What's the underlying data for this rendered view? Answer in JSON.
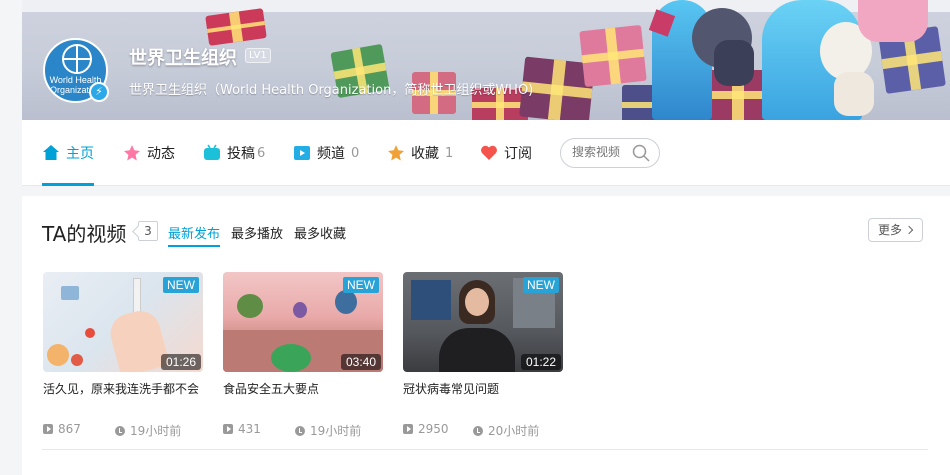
{
  "header": {
    "user_name": "世界卫生组织",
    "level": "LV1",
    "signature": "世界卫生组织（World Health Organization，简称世卫组织或WHO)",
    "avatar_text": "World Health Organization"
  },
  "nav": {
    "items": [
      {
        "label": "主页",
        "count": "",
        "icon": "home-icon",
        "color": "#00a1d6"
      },
      {
        "label": "动态",
        "count": "",
        "icon": "dynamic-icon",
        "color": "#ff77a5"
      },
      {
        "label": "投稿",
        "count": "6",
        "icon": "upload-icon",
        "color": "#1cc0d9"
      },
      {
        "label": "频道",
        "count": "0",
        "icon": "channel-icon",
        "color": "#23ade5"
      },
      {
        "label": "收藏",
        "count": "1",
        "icon": "favorite-icon",
        "color": "#f0a137"
      },
      {
        "label": "订阅",
        "count": "",
        "icon": "subscribe-icon",
        "color": "#f5544d"
      }
    ],
    "search_placeholder": "搜索视频"
  },
  "videos_section": {
    "title": "TA的视频",
    "count": "3",
    "sort_options": [
      "最新发布",
      "最多播放",
      "最多收藏"
    ],
    "active_sort": "最新发布",
    "more_label": "更多",
    "items": [
      {
        "title": "活久见，原来我连洗手都不会",
        "duration": "01:26",
        "tag": "NEW",
        "plays": "867",
        "time": "19小时前"
      },
      {
        "title": "食品安全五大要点",
        "duration": "03:40",
        "tag": "NEW",
        "plays": "431",
        "time": "19小时前"
      },
      {
        "title": "冠状病毒常见问题",
        "duration": "01:22",
        "tag": "NEW",
        "plays": "2950",
        "time": "20小时前"
      }
    ]
  },
  "colors": {
    "accent": "#00a1d6",
    "new_tag": "#27a3d7"
  }
}
